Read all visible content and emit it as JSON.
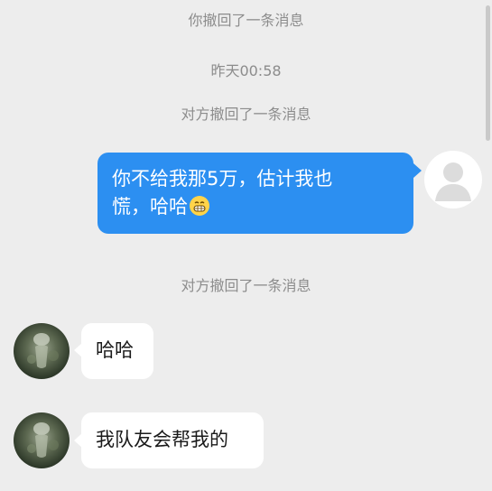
{
  "system": {
    "you_recalled": "你撤回了一条消息",
    "timestamp": "昨天00:58",
    "other_recalled_1": "对方撤回了一条消息",
    "other_recalled_2": "对方撤回了一条消息"
  },
  "messages": {
    "outgoing_1": {
      "line1": "你不给我那5万，估计我也",
      "line2": "慌，哈哈"
    },
    "incoming_1": "哈哈",
    "incoming_2": "我队友会帮我的"
  },
  "icons": {
    "emoji": "grinning-face-emoji",
    "own_avatar": "default-user-avatar",
    "other_avatar": "contact-photo-avatar"
  },
  "colors": {
    "background": "#ededed",
    "outgoing_bubble": "#2c8ff1",
    "incoming_bubble": "#ffffff",
    "system_text": "#8c8c8c"
  }
}
